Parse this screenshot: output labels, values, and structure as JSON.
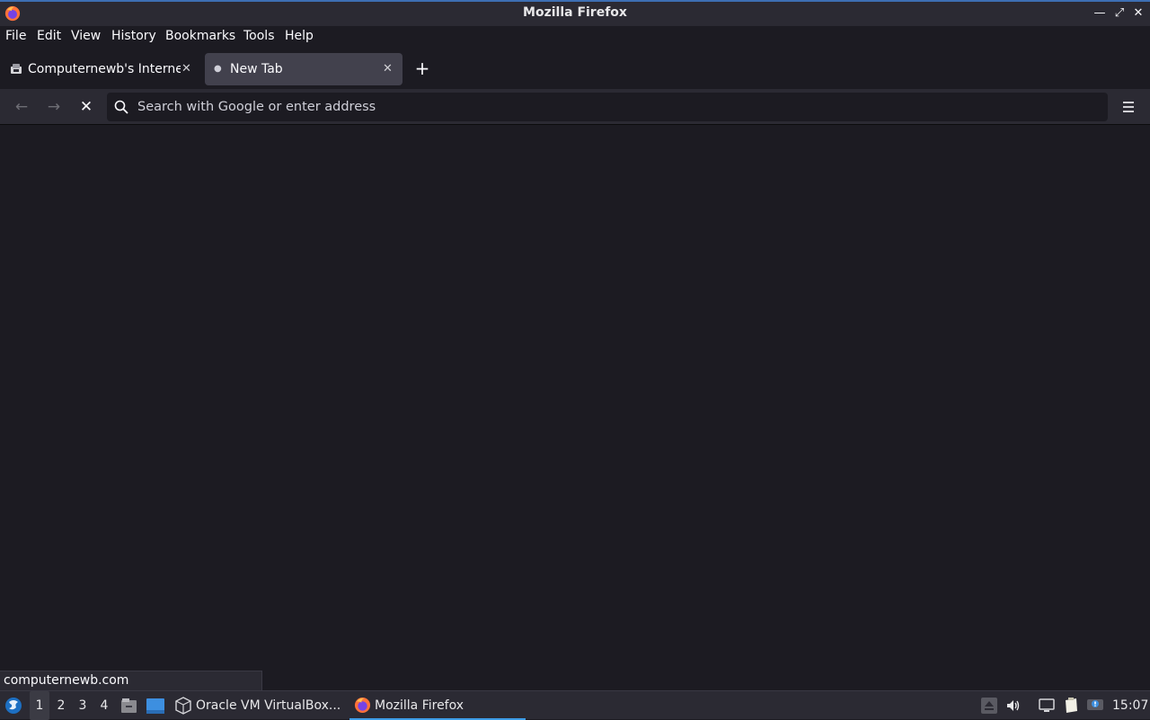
{
  "window": {
    "title": "Mozilla Firefox"
  },
  "menu": [
    {
      "label": "File"
    },
    {
      "label": "Edit"
    },
    {
      "label": "View"
    },
    {
      "label": "History"
    },
    {
      "label": "Bookmarks"
    },
    {
      "label": "Tools"
    },
    {
      "label": "Help"
    }
  ],
  "tabs": [
    {
      "label": "Computernewb's Internet",
      "icon": "favicon-icon",
      "active": false
    },
    {
      "label": "New Tab",
      "icon": "dot-icon",
      "active": true
    }
  ],
  "nav": {
    "url_placeholder": "Search with Google or enter address",
    "url_value": ""
  },
  "status": {
    "link": "computernewb.com"
  },
  "taskbar": {
    "workspaces": [
      "1",
      "2",
      "3",
      "4"
    ],
    "active_workspace": "1",
    "tasks": [
      {
        "label": "Oracle VM VirtualBox...",
        "icon": "virtualbox-icon",
        "active": false
      },
      {
        "label": "Mozilla Firefox",
        "icon": "firefox-icon",
        "active": true
      }
    ],
    "clock": "15:07"
  },
  "colors": {
    "background": "#1c1b22",
    "toolbar": "#2b2a33",
    "active_tab": "#42414d",
    "accent": "#3d9ce6"
  }
}
